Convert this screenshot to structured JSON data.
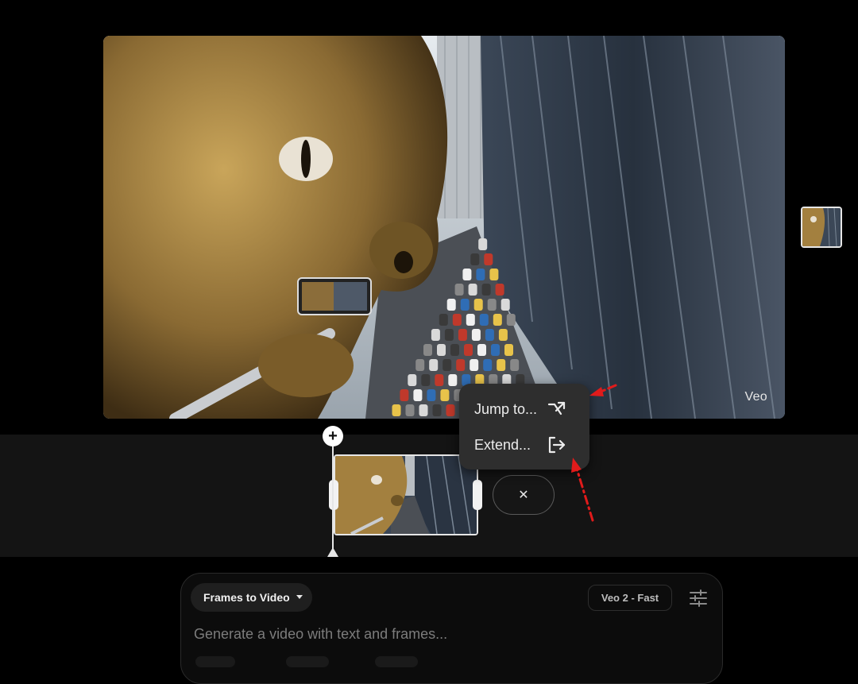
{
  "preview": {
    "watermark": "Veo",
    "image_icon": "dragon-selfie-image"
  },
  "timeline": {
    "add_icon": "plus-icon",
    "add_label": "+",
    "close_icon": "close-icon",
    "close_label": "✕",
    "clip_icon": "video-clip-thumbnail"
  },
  "menu": {
    "items": [
      {
        "label": "Jump to...",
        "icon": "shuffle-arrow-icon"
      },
      {
        "label": "Extend...",
        "icon": "exit-arrow-icon"
      }
    ]
  },
  "prompt": {
    "mode_label": "Frames to Video",
    "model_label": "Veo 2 - Fast",
    "settings_icon": "sliders-icon",
    "placeholder": "Generate a video with text and frames..."
  },
  "colors": {
    "background": "#000000",
    "timeline_bg": "#141414",
    "menu_bg": "#2e2e2e",
    "annotation_red": "#e01b1b"
  }
}
